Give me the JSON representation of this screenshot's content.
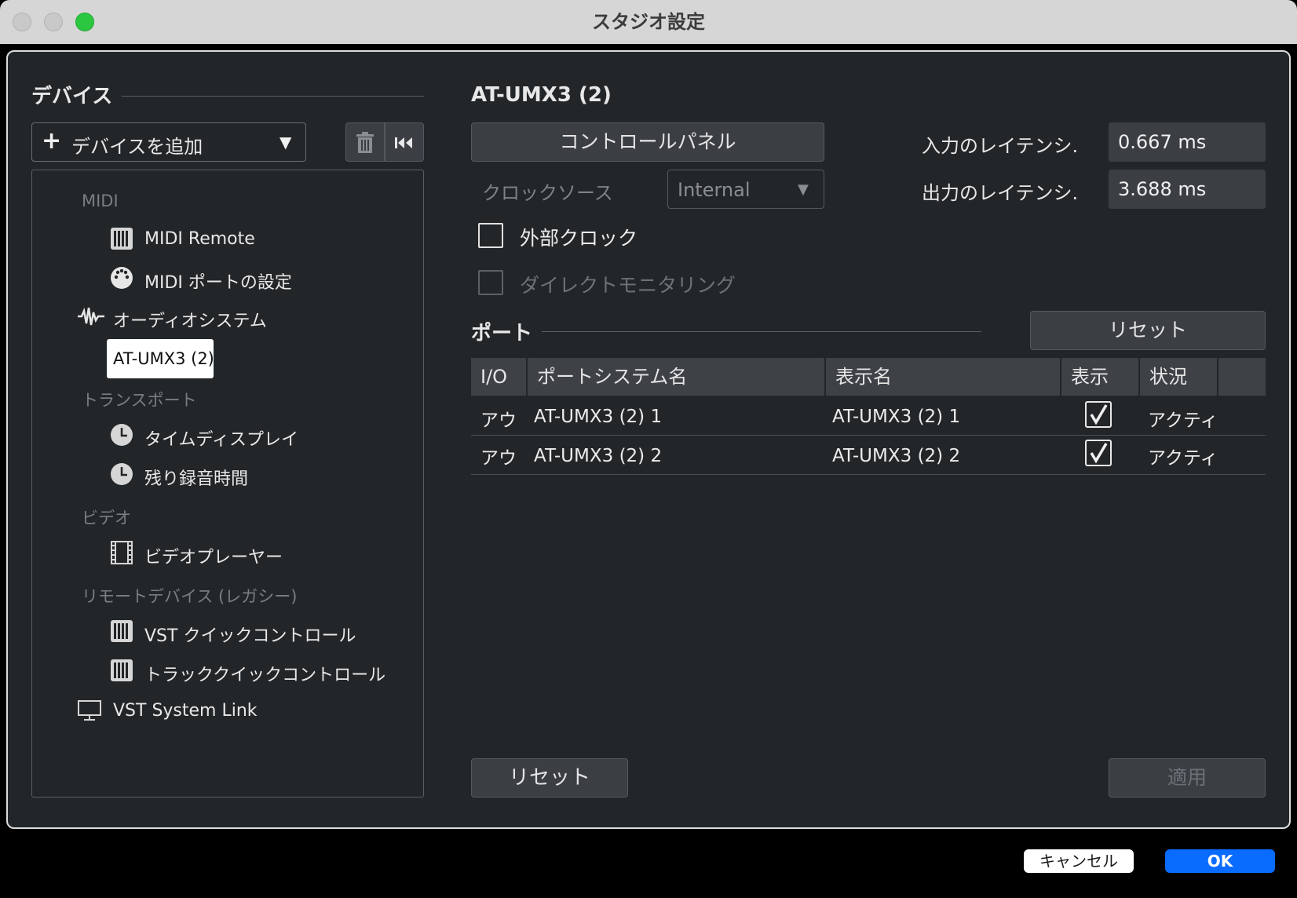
{
  "window": {
    "title": "スタジオ設定"
  },
  "devices": {
    "header": "デバイス",
    "add_button": "デバイスを追加",
    "tree": [
      {
        "type": "category",
        "label": "MIDI"
      },
      {
        "type": "item",
        "label": "MIDI Remote",
        "icon": "midi-keys-icon"
      },
      {
        "type": "item",
        "label": "MIDI ポートの設定",
        "icon": "midi-port-icon"
      },
      {
        "type": "group",
        "label": "オーディオシステム",
        "icon": "waveform-icon"
      },
      {
        "type": "selected",
        "label": "AT-UMX3 (2)"
      },
      {
        "type": "category",
        "label": "トランスポート"
      },
      {
        "type": "item",
        "label": "タイムディスプレイ",
        "icon": "clock-icon"
      },
      {
        "type": "item",
        "label": "残り録音時間",
        "icon": "clock-icon"
      },
      {
        "type": "category",
        "label": "ビデオ"
      },
      {
        "type": "item",
        "label": "ビデオプレーヤー",
        "icon": "film-icon"
      },
      {
        "type": "category",
        "label": "リモートデバイス (レガシー)"
      },
      {
        "type": "item",
        "label": "VST クイックコントロール",
        "icon": "midi-keys-icon"
      },
      {
        "type": "item",
        "label": "トラッククイックコントロール",
        "icon": "midi-keys-icon"
      },
      {
        "type": "group",
        "label": "VST System Link",
        "icon": "monitor-icon"
      }
    ]
  },
  "detail": {
    "device_name": "AT-UMX3 (2)",
    "control_panel": "コントロールパネル",
    "clock_source_label": "クロックソース",
    "clock_source_value": "Internal",
    "input_latency_label": "入力のレイテンシ.",
    "input_latency_value": "0.667 ms",
    "output_latency_label": "出力のレイテンシ.",
    "output_latency_value": "3.688 ms",
    "external_clock": "外部クロック",
    "direct_monitoring": "ダイレクトモニタリング",
    "ports_header": "ポート",
    "ports_reset": "リセット",
    "columns": [
      "I/O",
      "ポートシステム名",
      "表示名",
      "表示",
      "状況"
    ],
    "rows": [
      {
        "io": "アウ",
        "system_name": "AT-UMX3 (2) 1",
        "display_name": "AT-UMX3 (2) 1",
        "visible": true,
        "status": "アクティ"
      },
      {
        "io": "アウ",
        "system_name": "AT-UMX3 (2) 2",
        "display_name": "AT-UMX3 (2) 2",
        "visible": true,
        "status": "アクティ"
      }
    ],
    "reset_button": "リセット",
    "apply_button": "適用"
  },
  "footer": {
    "cancel": "キャンセル",
    "ok": "OK"
  },
  "colors": {
    "accent": "#0a6cff",
    "panel": "#232629",
    "field": "#3b3f44"
  }
}
